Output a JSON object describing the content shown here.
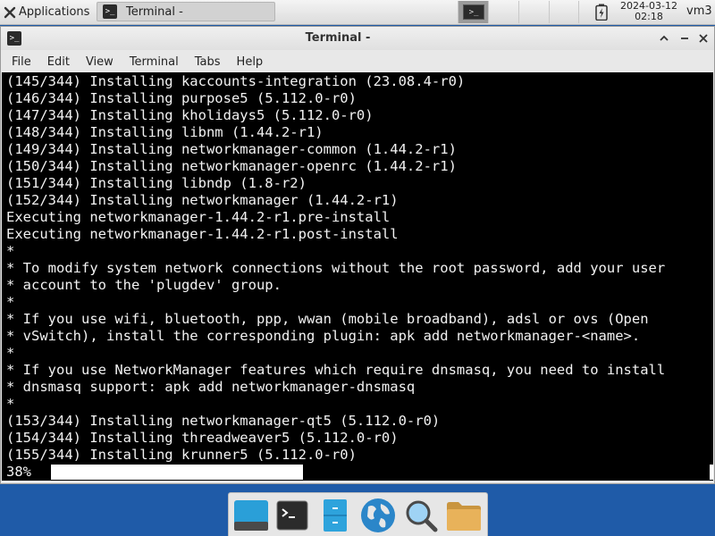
{
  "panel": {
    "applications_label": "Applications",
    "task_label": "Terminal -",
    "date": "2024-03-12",
    "time": "02:18",
    "user": "vm3"
  },
  "window": {
    "title": "Terminal -",
    "menu": [
      "File",
      "Edit",
      "View",
      "Terminal",
      "Tabs",
      "Help"
    ]
  },
  "terminal": {
    "lines": [
      "(145/344) Installing kaccounts-integration (23.08.4-r0)",
      "(146/344) Installing purpose5 (5.112.0-r0)",
      "(147/344) Installing kholidays5 (5.112.0-r0)",
      "(148/344) Installing libnm (1.44.2-r1)",
      "(149/344) Installing networkmanager-common (1.44.2-r1)",
      "(150/344) Installing networkmanager-openrc (1.44.2-r1)",
      "(151/344) Installing libndp (1.8-r2)",
      "(152/344) Installing networkmanager (1.44.2-r1)",
      "Executing networkmanager-1.44.2-r1.pre-install",
      "Executing networkmanager-1.44.2-r1.post-install",
      "*",
      "* To modify system network connections without the root password, add your user",
      "* account to the 'plugdev' group.",
      "*",
      "* If you use wifi, bluetooth, ppp, wwan (mobile broadband), adsl or ovs (Open",
      "* vSwitch), install the corresponding plugin: apk add networkmanager-<name>.",
      "*",
      "* If you use NetworkManager features which require dnsmasq, you need to install",
      "* dnsmasq support: apk add networkmanager-dnsmasq",
      "*",
      "(153/344) Installing networkmanager-qt5 (5.112.0-r0)",
      "(154/344) Installing threadweaver5 (5.112.0-r0)",
      "(155/344) Installing krunner5 (5.112.0-r0)"
    ],
    "progress_label": "38%",
    "progress_fraction": 0.38
  },
  "dock": {
    "items": [
      "show-desktop",
      "terminal",
      "file-manager",
      "web-browser",
      "app-finder",
      "home-folder"
    ]
  },
  "colors": {
    "desktop": "#1f5ba8",
    "terminal_bg": "#000000",
    "terminal_fg": "#f2f2f2"
  }
}
